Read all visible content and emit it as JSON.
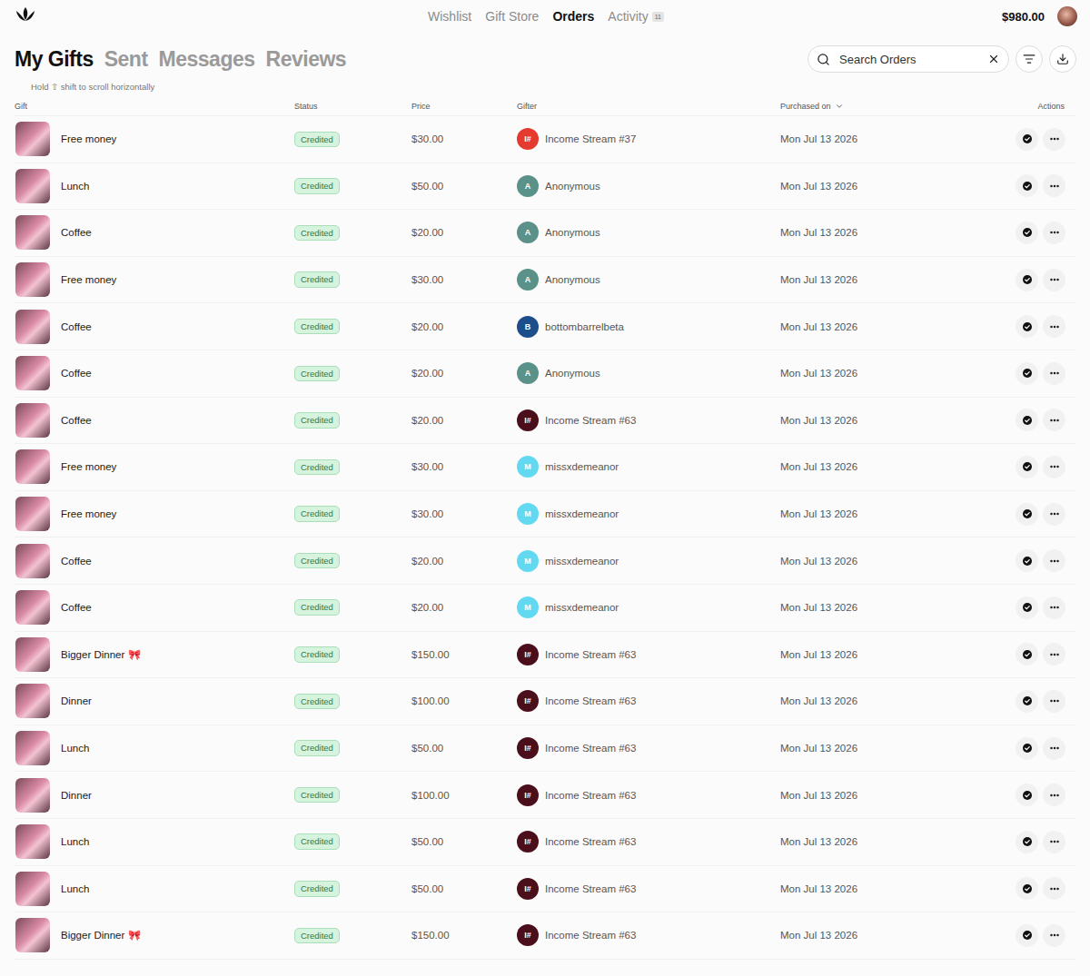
{
  "nav": {
    "items": [
      {
        "label": "Wishlist",
        "selected": false
      },
      {
        "label": "Gift Store",
        "selected": false
      },
      {
        "label": "Orders",
        "selected": true
      },
      {
        "label": "Activity",
        "selected": false,
        "badge": "11"
      }
    ],
    "balance": "$980.00"
  },
  "tabs": [
    {
      "label": "My Gifts",
      "selected": true
    },
    {
      "label": "Sent",
      "selected": false
    },
    {
      "label": "Messages",
      "selected": false
    },
    {
      "label": "Reviews",
      "selected": false
    }
  ],
  "search": {
    "placeholder": "Search Orders"
  },
  "hint": "Hold ⇧ shift to scroll horizontally",
  "table": {
    "columns": [
      {
        "label": "Gift",
        "sorted": false
      },
      {
        "label": "Status",
        "sorted": false
      },
      {
        "label": "Price",
        "sorted": false
      },
      {
        "label": "Gifter",
        "sorted": false
      },
      {
        "label": "Purchased on",
        "sorted": true
      },
      {
        "label": "Actions",
        "sorted": false
      }
    ],
    "rows": [
      {
        "gift": "Free money",
        "status": "Credited",
        "price": "$30.00",
        "gifter": {
          "name": "Income Stream #37",
          "initial": "I#",
          "color": "#e53a2f"
        },
        "date": "Mon Jul 13 2026"
      },
      {
        "gift": "Lunch",
        "status": "Credited",
        "price": "$50.00",
        "gifter": {
          "name": "Anonymous",
          "initial": "A",
          "color": "#5a9189"
        },
        "date": "Mon Jul 13 2026"
      },
      {
        "gift": "Coffee",
        "status": "Credited",
        "price": "$20.00",
        "gifter": {
          "name": "Anonymous",
          "initial": "A",
          "color": "#5a9189"
        },
        "date": "Mon Jul 13 2026"
      },
      {
        "gift": "Free money",
        "status": "Credited",
        "price": "$30.00",
        "gifter": {
          "name": "Anonymous",
          "initial": "A",
          "color": "#5a9189"
        },
        "date": "Mon Jul 13 2026"
      },
      {
        "gift": "Coffee",
        "status": "Credited",
        "price": "$20.00",
        "gifter": {
          "name": "bottombarrelbeta",
          "initial": "B",
          "color": "#1d4e8c"
        },
        "date": "Mon Jul 13 2026"
      },
      {
        "gift": "Coffee",
        "status": "Credited",
        "price": "$20.00",
        "gifter": {
          "name": "Anonymous",
          "initial": "A",
          "color": "#5a9189"
        },
        "date": "Mon Jul 13 2026"
      },
      {
        "gift": "Coffee",
        "status": "Credited",
        "price": "$20.00",
        "gifter": {
          "name": "Income Stream #63",
          "initial": "I#",
          "color": "#4a0f1a"
        },
        "date": "Mon Jul 13 2026"
      },
      {
        "gift": "Free money",
        "status": "Credited",
        "price": "$30.00",
        "gifter": {
          "name": "missxdemeanor",
          "initial": "M",
          "color": "#62d9f0"
        },
        "date": "Mon Jul 13 2026"
      },
      {
        "gift": "Free money",
        "status": "Credited",
        "price": "$30.00",
        "gifter": {
          "name": "missxdemeanor",
          "initial": "M",
          "color": "#62d9f0"
        },
        "date": "Mon Jul 13 2026"
      },
      {
        "gift": "Coffee",
        "status": "Credited",
        "price": "$20.00",
        "gifter": {
          "name": "missxdemeanor",
          "initial": "M",
          "color": "#62d9f0"
        },
        "date": "Mon Jul 13 2026"
      },
      {
        "gift": "Coffee",
        "status": "Credited",
        "price": "$20.00",
        "gifter": {
          "name": "missxdemeanor",
          "initial": "M",
          "color": "#62d9f0"
        },
        "date": "Mon Jul 13 2026"
      },
      {
        "gift": "Bigger Dinner 🎀",
        "status": "Credited",
        "price": "$150.00",
        "gifter": {
          "name": "Income Stream #63",
          "initial": "I#",
          "color": "#4a0f1a"
        },
        "date": "Mon Jul 13 2026"
      },
      {
        "gift": "Dinner",
        "status": "Credited",
        "price": "$100.00",
        "gifter": {
          "name": "Income Stream #63",
          "initial": "I#",
          "color": "#4a0f1a"
        },
        "date": "Mon Jul 13 2026"
      },
      {
        "gift": "Lunch",
        "status": "Credited",
        "price": "$50.00",
        "gifter": {
          "name": "Income Stream #63",
          "initial": "I#",
          "color": "#4a0f1a"
        },
        "date": "Mon Jul 13 2026"
      },
      {
        "gift": "Dinner",
        "status": "Credited",
        "price": "$100.00",
        "gifter": {
          "name": "Income Stream #63",
          "initial": "I#",
          "color": "#4a0f1a"
        },
        "date": "Mon Jul 13 2026"
      },
      {
        "gift": "Lunch",
        "status": "Credited",
        "price": "$50.00",
        "gifter": {
          "name": "Income Stream #63",
          "initial": "I#",
          "color": "#4a0f1a"
        },
        "date": "Mon Jul 13 2026"
      },
      {
        "gift": "Lunch",
        "status": "Credited",
        "price": "$50.00",
        "gifter": {
          "name": "Income Stream #63",
          "initial": "I#",
          "color": "#4a0f1a"
        },
        "date": "Mon Jul 13 2026"
      },
      {
        "gift": "Bigger Dinner 🎀",
        "status": "Credited",
        "price": "$150.00",
        "gifter": {
          "name": "Income Stream #63",
          "initial": "I#",
          "color": "#4a0f1a"
        },
        "date": "Mon Jul 13 2026"
      }
    ]
  }
}
